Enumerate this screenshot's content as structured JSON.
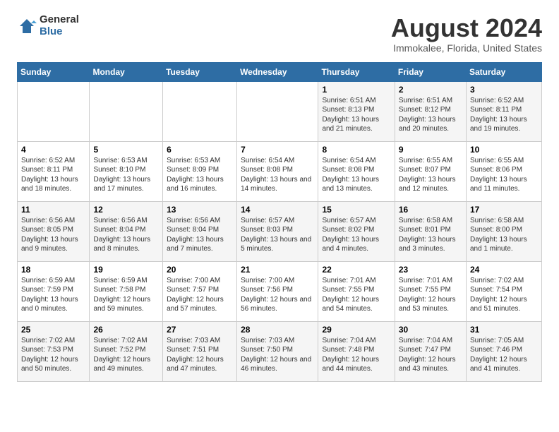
{
  "logo": {
    "general": "General",
    "blue": "Blue"
  },
  "title": "August 2024",
  "subtitle": "Immokalee, Florida, United States",
  "days_of_week": [
    "Sunday",
    "Monday",
    "Tuesday",
    "Wednesday",
    "Thursday",
    "Friday",
    "Saturday"
  ],
  "weeks": [
    [
      {
        "day": "",
        "info": ""
      },
      {
        "day": "",
        "info": ""
      },
      {
        "day": "",
        "info": ""
      },
      {
        "day": "",
        "info": ""
      },
      {
        "day": "1",
        "info": "Sunrise: 6:51 AM\nSunset: 8:13 PM\nDaylight: 13 hours and 21 minutes."
      },
      {
        "day": "2",
        "info": "Sunrise: 6:51 AM\nSunset: 8:12 PM\nDaylight: 13 hours and 20 minutes."
      },
      {
        "day": "3",
        "info": "Sunrise: 6:52 AM\nSunset: 8:11 PM\nDaylight: 13 hours and 19 minutes."
      }
    ],
    [
      {
        "day": "4",
        "info": "Sunrise: 6:52 AM\nSunset: 8:11 PM\nDaylight: 13 hours and 18 minutes."
      },
      {
        "day": "5",
        "info": "Sunrise: 6:53 AM\nSunset: 8:10 PM\nDaylight: 13 hours and 17 minutes."
      },
      {
        "day": "6",
        "info": "Sunrise: 6:53 AM\nSunset: 8:09 PM\nDaylight: 13 hours and 16 minutes."
      },
      {
        "day": "7",
        "info": "Sunrise: 6:54 AM\nSunset: 8:08 PM\nDaylight: 13 hours and 14 minutes."
      },
      {
        "day": "8",
        "info": "Sunrise: 6:54 AM\nSunset: 8:08 PM\nDaylight: 13 hours and 13 minutes."
      },
      {
        "day": "9",
        "info": "Sunrise: 6:55 AM\nSunset: 8:07 PM\nDaylight: 13 hours and 12 minutes."
      },
      {
        "day": "10",
        "info": "Sunrise: 6:55 AM\nSunset: 8:06 PM\nDaylight: 13 hours and 11 minutes."
      }
    ],
    [
      {
        "day": "11",
        "info": "Sunrise: 6:56 AM\nSunset: 8:05 PM\nDaylight: 13 hours and 9 minutes."
      },
      {
        "day": "12",
        "info": "Sunrise: 6:56 AM\nSunset: 8:04 PM\nDaylight: 13 hours and 8 minutes."
      },
      {
        "day": "13",
        "info": "Sunrise: 6:56 AM\nSunset: 8:04 PM\nDaylight: 13 hours and 7 minutes."
      },
      {
        "day": "14",
        "info": "Sunrise: 6:57 AM\nSunset: 8:03 PM\nDaylight: 13 hours and 5 minutes."
      },
      {
        "day": "15",
        "info": "Sunrise: 6:57 AM\nSunset: 8:02 PM\nDaylight: 13 hours and 4 minutes."
      },
      {
        "day": "16",
        "info": "Sunrise: 6:58 AM\nSunset: 8:01 PM\nDaylight: 13 hours and 3 minutes."
      },
      {
        "day": "17",
        "info": "Sunrise: 6:58 AM\nSunset: 8:00 PM\nDaylight: 13 hours and 1 minute."
      }
    ],
    [
      {
        "day": "18",
        "info": "Sunrise: 6:59 AM\nSunset: 7:59 PM\nDaylight: 13 hours and 0 minutes."
      },
      {
        "day": "19",
        "info": "Sunrise: 6:59 AM\nSunset: 7:58 PM\nDaylight: 12 hours and 59 minutes."
      },
      {
        "day": "20",
        "info": "Sunrise: 7:00 AM\nSunset: 7:57 PM\nDaylight: 12 hours and 57 minutes."
      },
      {
        "day": "21",
        "info": "Sunrise: 7:00 AM\nSunset: 7:56 PM\nDaylight: 12 hours and 56 minutes."
      },
      {
        "day": "22",
        "info": "Sunrise: 7:01 AM\nSunset: 7:55 PM\nDaylight: 12 hours and 54 minutes."
      },
      {
        "day": "23",
        "info": "Sunrise: 7:01 AM\nSunset: 7:55 PM\nDaylight: 12 hours and 53 minutes."
      },
      {
        "day": "24",
        "info": "Sunrise: 7:02 AM\nSunset: 7:54 PM\nDaylight: 12 hours and 51 minutes."
      }
    ],
    [
      {
        "day": "25",
        "info": "Sunrise: 7:02 AM\nSunset: 7:53 PM\nDaylight: 12 hours and 50 minutes."
      },
      {
        "day": "26",
        "info": "Sunrise: 7:02 AM\nSunset: 7:52 PM\nDaylight: 12 hours and 49 minutes."
      },
      {
        "day": "27",
        "info": "Sunrise: 7:03 AM\nSunset: 7:51 PM\nDaylight: 12 hours and 47 minutes."
      },
      {
        "day": "28",
        "info": "Sunrise: 7:03 AM\nSunset: 7:50 PM\nDaylight: 12 hours and 46 minutes."
      },
      {
        "day": "29",
        "info": "Sunrise: 7:04 AM\nSunset: 7:48 PM\nDaylight: 12 hours and 44 minutes."
      },
      {
        "day": "30",
        "info": "Sunrise: 7:04 AM\nSunset: 7:47 PM\nDaylight: 12 hours and 43 minutes."
      },
      {
        "day": "31",
        "info": "Sunrise: 7:05 AM\nSunset: 7:46 PM\nDaylight: 12 hours and 41 minutes."
      }
    ]
  ]
}
